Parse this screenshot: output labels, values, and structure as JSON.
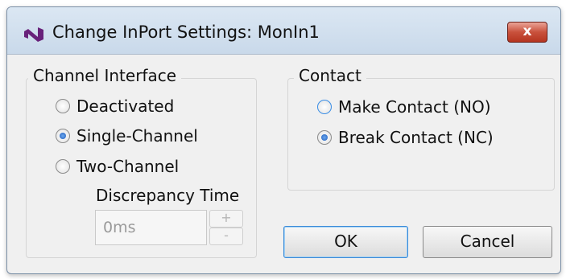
{
  "window": {
    "title": "Change InPort Settings: MonIn1",
    "close_glyph": "x"
  },
  "channel_interface": {
    "legend": "Channel Interface",
    "options": [
      {
        "label": "Deactivated",
        "checked": false
      },
      {
        "label": "Single-Channel",
        "checked": true
      },
      {
        "label": "Two-Channel",
        "checked": false
      }
    ],
    "discrepancy": {
      "label": "Discrepancy Time",
      "value": "0ms",
      "increment": "+",
      "decrement": "-"
    }
  },
  "contact": {
    "legend": "Contact",
    "options": [
      {
        "label": "Make Contact (NO)",
        "checked": false
      },
      {
        "label": "Break Contact (NC)",
        "checked": true
      }
    ]
  },
  "buttons": {
    "ok": "OK",
    "cancel": "Cancel"
  },
  "colors": {
    "accent": "#3b8ad8",
    "app_icon": "#68217a"
  }
}
